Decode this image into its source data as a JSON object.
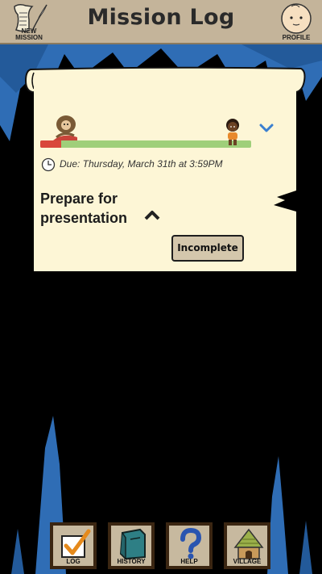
{
  "header": {
    "title": "Mission Log",
    "new_mission_label": "NEW MISSION",
    "profile_label": "PROFILE"
  },
  "mission": {
    "due_text": "Due: Thursday, March 31th at 3:59PM",
    "title": "Prepare for presentation",
    "status_button_label": "Incomplete",
    "progress_fraction": 0.1
  },
  "nav": {
    "log_label": "LOG",
    "history_label": "HISTORY",
    "help_label": "HELP",
    "village_label": "VILLAGE"
  },
  "icons": {
    "new_mission": "scroll-quill-icon",
    "profile": "face-icon",
    "expand": "chevron-down-icon",
    "collapse": "chevron-up-icon",
    "clock": "clock-icon",
    "log": "checkmark-icon",
    "history": "book-icon",
    "help": "question-mark-icon",
    "village": "hut-icon"
  },
  "colors": {
    "header_bg": "#c4b49a",
    "scroll_bg": "#fdf6d6",
    "progress_green": "#9fcf7a",
    "progress_red": "#d9473b",
    "cave_blue": "#2f6db5",
    "chevron_blue": "#3a7fd0"
  }
}
